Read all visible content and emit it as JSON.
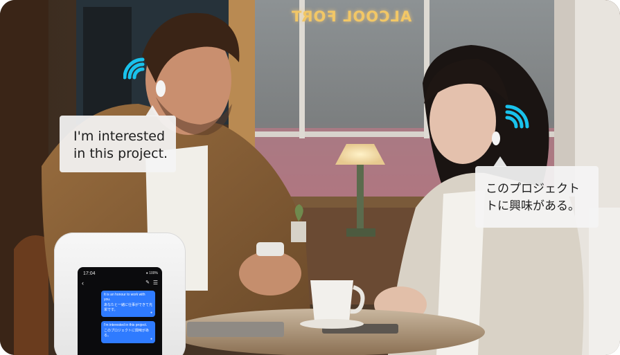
{
  "scene": {
    "sign_text": "ALCOOL FORT"
  },
  "bubbles": {
    "english_line1": "I'm interested",
    "english_line2": "in this project.",
    "japanese_line1": "このプロジェクト",
    "japanese_line2": "トに興味がある。"
  },
  "device": {
    "time": "17:04",
    "battery": "100%",
    "messages": [
      {
        "source": "It is an honour to work with you.",
        "translation": "あなたと一緒に仕事ができて光栄です。"
      },
      {
        "source": "I'm interested in this project.",
        "translation": "このプロジェクトに興味がある。"
      }
    ]
  },
  "colors": {
    "wave": "#19c2ec",
    "bubble_bg": "#f4f4f4",
    "device_msg": "#2f7bff",
    "sign_glow": "#f2c766"
  }
}
